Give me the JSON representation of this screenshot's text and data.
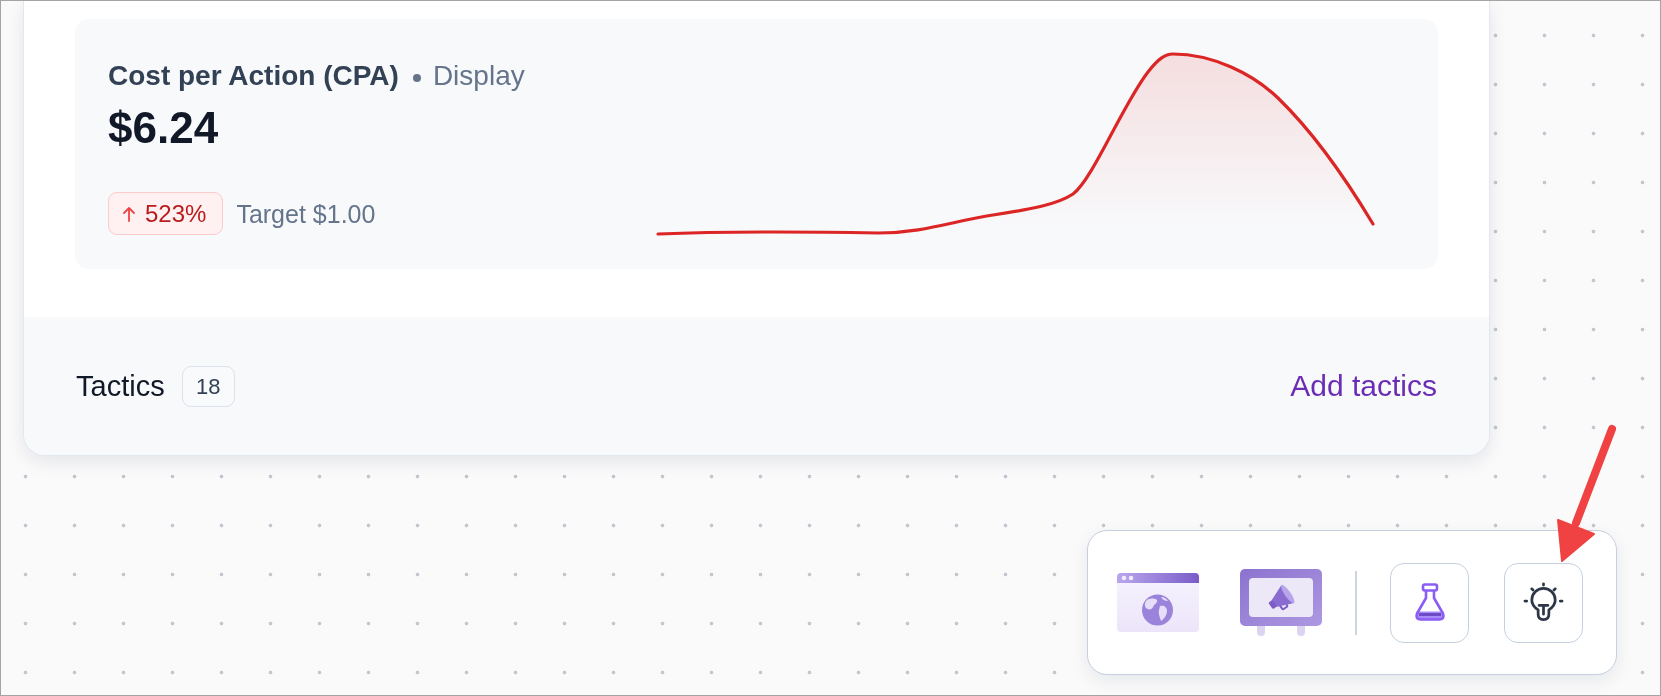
{
  "metric_card": {
    "title": "Cost per Action (CPA)",
    "channel": "Display",
    "value": "$6.24",
    "change": {
      "increase": true,
      "text": "523%"
    },
    "target": "Target $1.00"
  },
  "footer": {
    "label": "Tactics",
    "count": "18",
    "action": "Add tactics"
  }
}
